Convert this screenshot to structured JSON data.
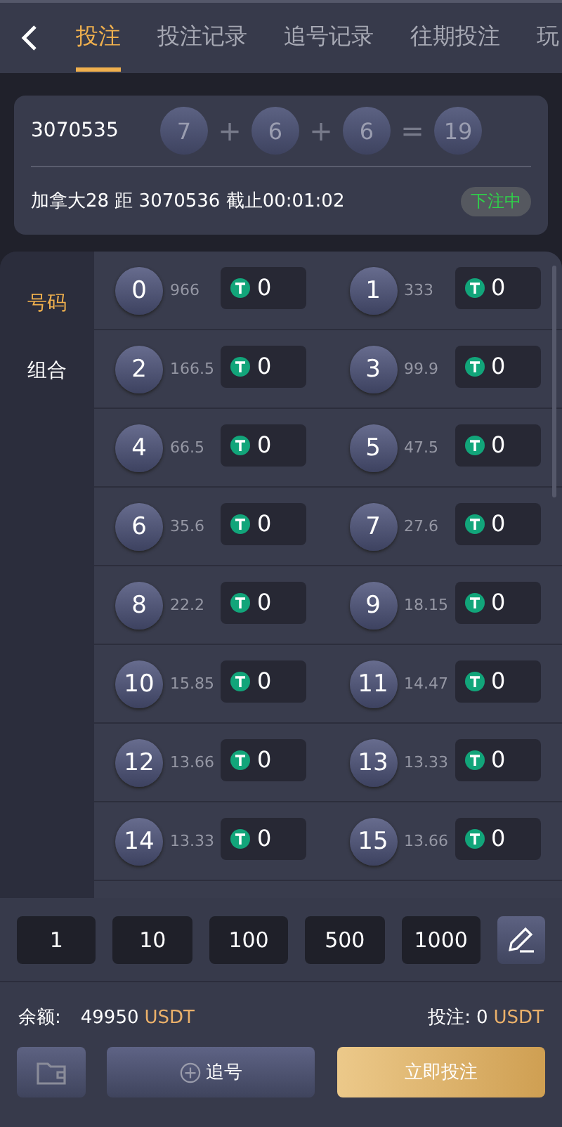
{
  "tabs": [
    {
      "label": "投注",
      "selected": true
    },
    {
      "label": "投注记录",
      "selected": false
    },
    {
      "label": "追号记录",
      "selected": false
    },
    {
      "label": "往期投注",
      "selected": false
    },
    {
      "label": "玩",
      "selected": false
    }
  ],
  "draw": {
    "issue": "3070535",
    "balls": [
      "7",
      "6",
      "6"
    ],
    "ops": [
      "+",
      "+",
      "="
    ],
    "sum": "19"
  },
  "next": {
    "text": "加拿大28 距 3070536 截止00:01:02",
    "status": "下注中"
  },
  "categories": [
    {
      "label": "号码",
      "selected": true
    },
    {
      "label": "组合",
      "selected": false
    }
  ],
  "numbers": [
    {
      "number": "0",
      "odds": "966",
      "amount": "0"
    },
    {
      "number": "1",
      "odds": "333",
      "amount": "0"
    },
    {
      "number": "2",
      "odds": "166.5",
      "amount": "0"
    },
    {
      "number": "3",
      "odds": "99.9",
      "amount": "0"
    },
    {
      "number": "4",
      "odds": "66.5",
      "amount": "0"
    },
    {
      "number": "5",
      "odds": "47.5",
      "amount": "0"
    },
    {
      "number": "6",
      "odds": "35.6",
      "amount": "0"
    },
    {
      "number": "7",
      "odds": "27.6",
      "amount": "0"
    },
    {
      "number": "8",
      "odds": "22.2",
      "amount": "0"
    },
    {
      "number": "9",
      "odds": "18.15",
      "amount": "0"
    },
    {
      "number": "10",
      "odds": "15.85",
      "amount": "0"
    },
    {
      "number": "11",
      "odds": "14.47",
      "amount": "0"
    },
    {
      "number": "12",
      "odds": "13.66",
      "amount": "0"
    },
    {
      "number": "13",
      "odds": "13.33",
      "amount": "0"
    },
    {
      "number": "14",
      "odds": "13.33",
      "amount": "0"
    },
    {
      "number": "15",
      "odds": "13.66",
      "amount": "0"
    }
  ],
  "chips": [
    "1",
    "10",
    "100",
    "500",
    "1000"
  ],
  "balance": {
    "label": "余额:",
    "value": "49950",
    "unit": "USDT"
  },
  "bet": {
    "label": "投注:",
    "value": "0",
    "unit": "USDT"
  },
  "buttons": {
    "chase": "追号",
    "submit": "立即投注"
  }
}
